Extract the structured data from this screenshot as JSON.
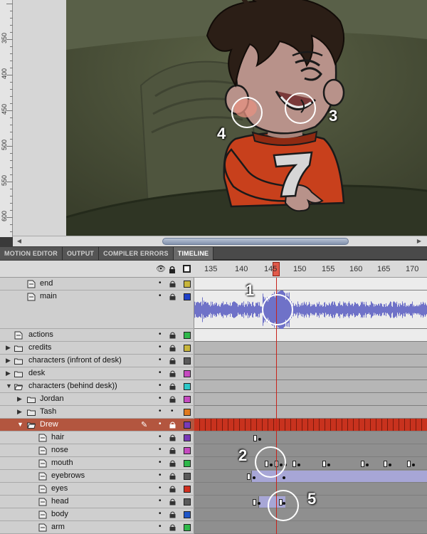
{
  "ruler": {
    "labels": [
      "350",
      "400",
      "450",
      "500",
      "550",
      "600"
    ]
  },
  "panel_tabs": [
    "MOTION EDITOR",
    "OUTPUT",
    "COMPILER ERRORS",
    "TIMELINE"
  ],
  "active_tab": "TIMELINE",
  "frame_numbers": [
    "135",
    "140",
    "145",
    "150",
    "155",
    "160",
    "165",
    "170"
  ],
  "layers": [
    {
      "name": "end",
      "indent": 2,
      "type": "layer",
      "color": "#c8b63c"
    },
    {
      "name": "main",
      "indent": 2,
      "type": "layer",
      "color": "#1e40c8"
    },
    {
      "name": "actions",
      "indent": 1,
      "type": "layer",
      "color": "#2eb84a"
    },
    {
      "name": "credits",
      "indent": 0,
      "type": "folder",
      "color": "#c8b63c"
    },
    {
      "name": "characters (infront of desk)",
      "indent": 0,
      "type": "folder",
      "color": "#5a5a5a"
    },
    {
      "name": "desk",
      "indent": 0,
      "type": "folder",
      "color": "#c64ac0"
    },
    {
      "name": "characters (behind desk))",
      "indent": 0,
      "type": "folder-open",
      "color": "#2ec8c8"
    },
    {
      "name": "Jordan",
      "indent": 1,
      "type": "folder",
      "color": "#c64ac0"
    },
    {
      "name": "Tash",
      "indent": 1,
      "type": "folder",
      "color": "#e07a1e"
    },
    {
      "name": "Drew",
      "indent": 1,
      "type": "folder-open",
      "color": "#7a3ab8"
    },
    {
      "name": "hair",
      "indent": 2,
      "type": "layer",
      "color": "#7a3ab8"
    },
    {
      "name": "nose",
      "indent": 2,
      "type": "layer",
      "color": "#c64ac0"
    },
    {
      "name": "mouth",
      "indent": 2,
      "type": "layer",
      "color": "#2eb84a"
    },
    {
      "name": "eyebrows",
      "indent": 2,
      "type": "layer",
      "color": "#5a5a5a"
    },
    {
      "name": "eyes",
      "indent": 2,
      "type": "layer",
      "color": "#d03020"
    },
    {
      "name": "head",
      "indent": 2,
      "type": "layer",
      "color": "#5a5a5a"
    },
    {
      "name": "body",
      "indent": 2,
      "type": "layer",
      "color": "#1e56c8"
    },
    {
      "name": "arm",
      "indent": 2,
      "type": "layer",
      "color": "#2eb84a"
    }
  ],
  "selected_layer": "Drew",
  "current_frame": 146,
  "callouts": [
    "1",
    "2",
    "3",
    "4",
    "5"
  ],
  "jersey_number": "7",
  "colors": {
    "selection": "#b3563f",
    "playhead": "#c8231a",
    "waveform": "#6f72c8",
    "tween": "#a7a6d6"
  }
}
